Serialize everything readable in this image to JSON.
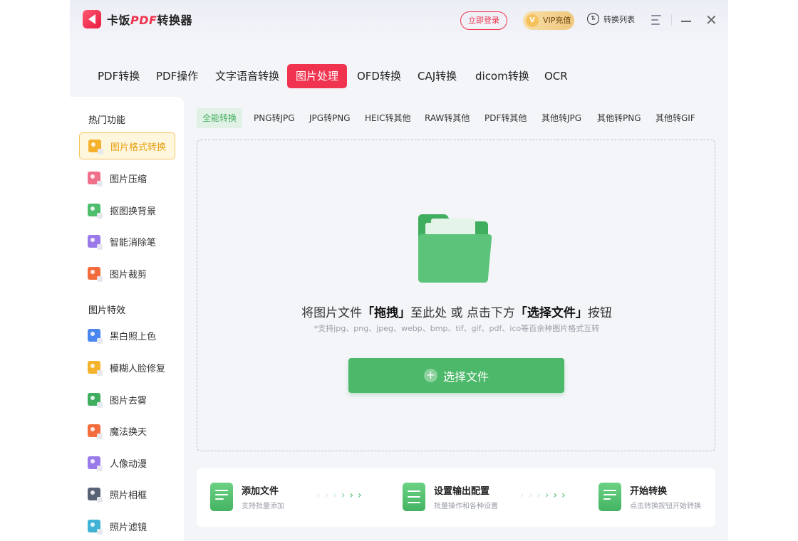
{
  "app": {
    "name_prefix": "卡饭",
    "name_accent": "PDF",
    "name_suffix": "转换器"
  },
  "header": {
    "login": "立即登录",
    "vip": "VIP充值",
    "conversion_list": "转换列表"
  },
  "main_tabs": [
    {
      "label": "PDF转换",
      "active": false
    },
    {
      "label": "PDF操作",
      "active": false
    },
    {
      "label": "文字语音转换",
      "active": false
    },
    {
      "label": "图片处理",
      "active": true
    },
    {
      "label": "OFD转换",
      "active": false
    },
    {
      "label": "CAJ转换",
      "active": false
    },
    {
      "label": "dicom转换",
      "active": false
    },
    {
      "label": "OCR",
      "active": false
    }
  ],
  "sidebar": {
    "section1": "热门功能",
    "items1": [
      {
        "label": "图片格式转换",
        "icon": "image-format-icon",
        "color": "#f5b22c",
        "active": true
      },
      {
        "label": "图片压缩",
        "icon": "image-compress-icon",
        "color": "#f06f8a",
        "active": false
      },
      {
        "label": "抠图换背景",
        "icon": "cutout-icon",
        "color": "#4ebd6c",
        "active": false
      },
      {
        "label": "智能消除笔",
        "icon": "eraser-icon",
        "color": "#9a7ae8",
        "active": false
      },
      {
        "label": "图片裁剪",
        "icon": "crop-icon",
        "color": "#f26c3d",
        "active": false
      }
    ],
    "section2": "图片特效",
    "items2": [
      {
        "label": "黑白照上色",
        "icon": "colorize-icon",
        "color": "#4a86f0",
        "active": false
      },
      {
        "label": "模糊人脸修复",
        "icon": "face-repair-icon",
        "color": "#f5b22c",
        "active": false
      },
      {
        "label": "图片去雾",
        "icon": "dehaze-icon",
        "color": "#3fae5e",
        "active": false
      },
      {
        "label": "魔法换天",
        "icon": "sky-replace-icon",
        "color": "#f26c3d",
        "active": false
      },
      {
        "label": "人像动漫",
        "icon": "anime-icon",
        "color": "#9a7ae8",
        "active": false
      },
      {
        "label": "照片相框",
        "icon": "photo-frame-icon",
        "color": "#5a6275",
        "active": false
      },
      {
        "label": "照片滤镜",
        "icon": "filter-icon",
        "color": "#3fb2d6",
        "active": false
      }
    ]
  },
  "sub_tabs": [
    {
      "label": "全能转换",
      "active": true
    },
    {
      "label": "PNG转JPG",
      "active": false
    },
    {
      "label": "JPG转PNG",
      "active": false
    },
    {
      "label": "HEIC转其他",
      "active": false
    },
    {
      "label": "RAW转其他",
      "active": false
    },
    {
      "label": "PDF转其他",
      "active": false
    },
    {
      "label": "其他转JPG",
      "active": false
    },
    {
      "label": "其他转PNG",
      "active": false
    },
    {
      "label": "其他转GIF",
      "active": false
    }
  ],
  "dropzone": {
    "t1": "将图片文件",
    "t2": "「拖拽」",
    "t3": "至此处 或 点击下方",
    "t4": "「选择文件」",
    "t5": "按钮",
    "hint": "*支持jpg、png、jpeg、webp、bmp、tif、gif、pdf、ico等百余种图片格式互转",
    "button": "选择文件"
  },
  "steps": [
    {
      "title": "添加文件",
      "desc": "支持批量添加"
    },
    {
      "title": "设置输出配置",
      "desc": "批量操作和各种设置"
    },
    {
      "title": "开始转换",
      "desc": "点击转换按钮开始转换"
    }
  ],
  "colors": {
    "brand": "#f0334f",
    "accent_green": "#4cb86a",
    "active_sidebar": "#e69f0e"
  }
}
